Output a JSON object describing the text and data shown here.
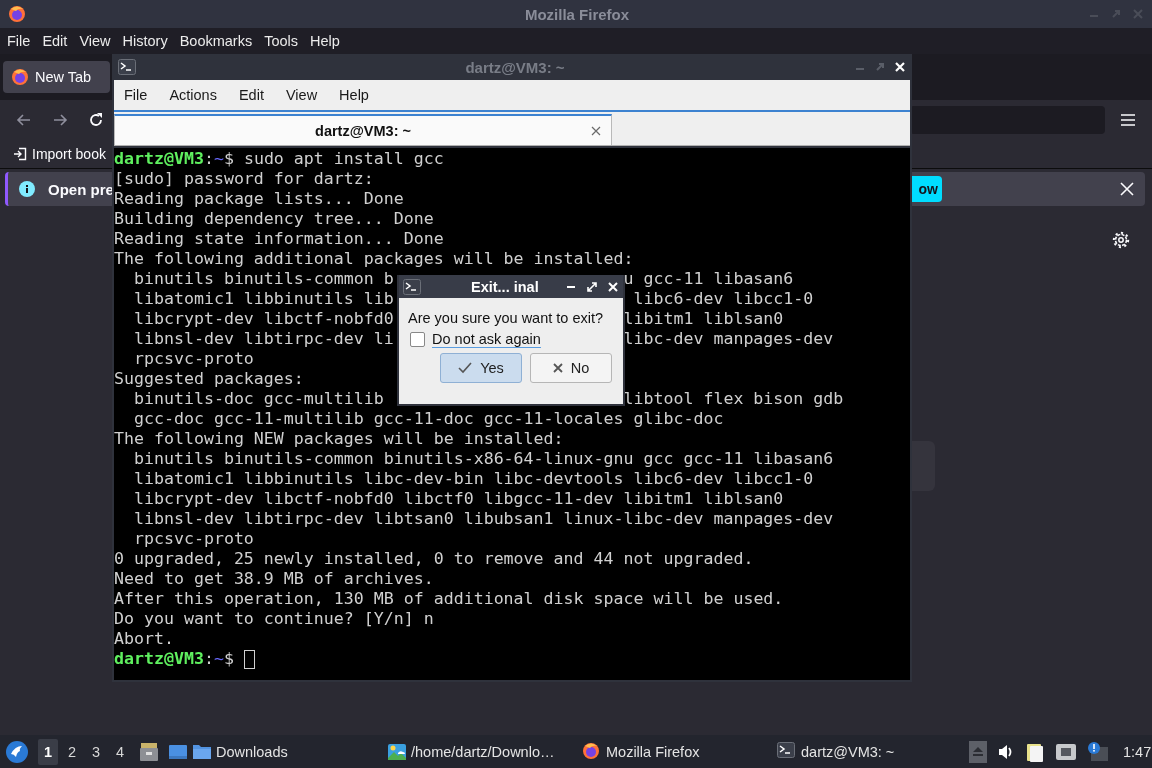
{
  "firefox": {
    "title": "Mozilla Firefox",
    "menu": [
      "File",
      "Edit",
      "View",
      "History",
      "Bookmarks",
      "Tools",
      "Help"
    ],
    "tabs": [
      {
        "label": "New Tab",
        "selected": true
      }
    ],
    "bookmarks": [
      "Import book"
    ],
    "notification": {
      "message": "Open pre",
      "button": "ow"
    }
  },
  "terminal": {
    "title": "dartz@VM3: ~",
    "menu": [
      "File",
      "Actions",
      "Edit",
      "View",
      "Help"
    ],
    "tabs": [
      {
        "label": "dartz@VM3: ~",
        "selected": true
      }
    ],
    "lines": [
      {
        "kind": "prompt",
        "user": "dartz@VM3",
        "sep": ":",
        "path": "~",
        "tail": "$ sudo apt install gcc",
        "cursor": false
      },
      {
        "kind": "text",
        "text": "[sudo] password for dartz:"
      },
      {
        "kind": "text",
        "text": "Reading package lists... Done"
      },
      {
        "kind": "text",
        "text": "Building dependency tree... Done"
      },
      {
        "kind": "text",
        "text": "Reading state information... Done"
      },
      {
        "kind": "text",
        "text": "The following additional packages will be installed:"
      },
      {
        "kind": "split",
        "left": "  binutils binutils-common b",
        "right": "u gcc-11 libasan6"
      },
      {
        "kind": "split",
        "left": "  libatomic1 libbinutils lib",
        "right": " libc6-dev libcc1-0"
      },
      {
        "kind": "split",
        "left": "  libcrypt-dev libctf-nobfd0",
        "right": "libitm1 liblsan0"
      },
      {
        "kind": "split",
        "left": "  libnsl-dev libtirpc-dev li",
        "right": "libc-dev manpages-dev"
      },
      {
        "kind": "text",
        "text": "  rpcsvc-proto"
      },
      {
        "kind": "text",
        "text": "Suggested packages:"
      },
      {
        "kind": "split",
        "left": "  binutils-doc gcc-multilib",
        "right": "libtool flex bison gdb"
      },
      {
        "kind": "text",
        "text": "  gcc-doc gcc-11-multilib gcc-11-doc gcc-11-locales glibc-doc"
      },
      {
        "kind": "text",
        "text": "The following NEW packages will be installed:"
      },
      {
        "kind": "text",
        "text": "  binutils binutils-common binutils-x86-64-linux-gnu gcc gcc-11 libasan6"
      },
      {
        "kind": "text",
        "text": "  libatomic1 libbinutils libc-dev-bin libc-devtools libc6-dev libcc1-0"
      },
      {
        "kind": "text",
        "text": "  libcrypt-dev libctf-nobfd0 libctf0 libgcc-11-dev libitm1 liblsan0"
      },
      {
        "kind": "text",
        "text": "  libnsl-dev libtirpc-dev libtsan0 libubsan1 linux-libc-dev manpages-dev"
      },
      {
        "kind": "text",
        "text": "  rpcsvc-proto"
      },
      {
        "kind": "text",
        "text": "0 upgraded, 25 newly installed, 0 to remove and 44 not upgraded."
      },
      {
        "kind": "text",
        "text": "Need to get 38.9 MB of archives."
      },
      {
        "kind": "text",
        "text": "After this operation, 130 MB of additional disk space will be used."
      },
      {
        "kind": "text",
        "text": "Do you want to continue? [Y/n] n"
      },
      {
        "kind": "text",
        "text": "Abort."
      },
      {
        "kind": "prompt",
        "user": "dartz@VM3",
        "sep": ":",
        "path": "~",
        "tail": "$ ",
        "cursor": true
      }
    ]
  },
  "dialog": {
    "title": "Exit... inal",
    "message": "Are you sure you want to exit?",
    "checkbox": {
      "label": "Do not ask again",
      "checked": false
    },
    "buttons": [
      {
        "label": "Yes",
        "kind": "accept",
        "default": true
      },
      {
        "label": "No",
        "kind": "reject",
        "default": false
      }
    ]
  },
  "taskbar": {
    "workspaces": [
      {
        "label": "1",
        "selected": true
      },
      {
        "label": "2",
        "selected": false
      },
      {
        "label": "3",
        "selected": false
      },
      {
        "label": "4",
        "selected": false
      }
    ],
    "tasks": [
      {
        "label": "Downloads",
        "kind": "folder"
      },
      {
        "label": "/home/dartz/Downlo…",
        "kind": "image"
      },
      {
        "label": "Mozilla Firefox",
        "kind": "browser"
      },
      {
        "label": "dartz@VM3: ~",
        "kind": "terminal"
      }
    ],
    "clock": "1:47"
  }
}
